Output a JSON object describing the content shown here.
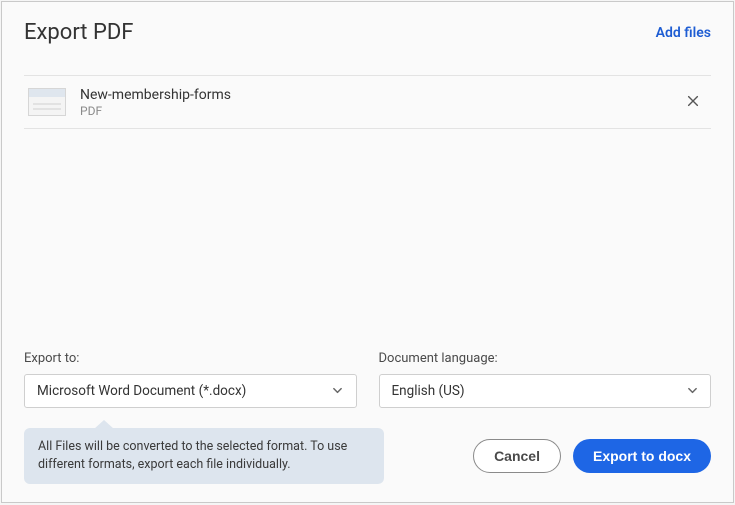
{
  "header": {
    "title": "Export PDF",
    "add_files": "Add files"
  },
  "file": {
    "name": "New-membership-forms",
    "type": "PDF"
  },
  "export_to": {
    "label": "Export to:",
    "value": "Microsoft Word Document (*.docx)"
  },
  "language": {
    "label": "Document language:",
    "value": "English (US)"
  },
  "tip": "All Files will be converted to the selected format. To use different formats, export each file individually.",
  "buttons": {
    "cancel": "Cancel",
    "export": "Export to docx"
  }
}
